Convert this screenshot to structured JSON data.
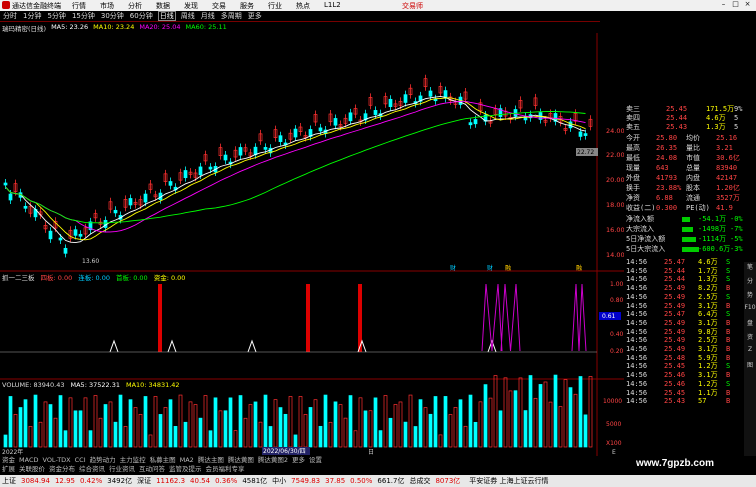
{
  "topbar": {
    "app_name": "通达信金融终端",
    "menu": [
      "行情",
      "市场",
      "分析",
      "数据",
      "发现",
      "交易",
      "服务",
      "行业",
      "热点",
      "L1L2"
    ],
    "brand": "交易师"
  },
  "periods": [
    "分时",
    "1分钟",
    "5分钟",
    "15分钟",
    "30分钟",
    "60分钟",
    "日线",
    "周线",
    "月线",
    "多周期",
    "更多"
  ],
  "stock": {
    "name": "瑞玛精密(日线)"
  },
  "ma": {
    "ma5": "MA5: 23.26",
    "ma10": "MA10: 23.24",
    "ma20": "MA20: 25.04",
    "ma60": "MA60: 25.11"
  },
  "colors": {
    "ma5": "#ffffff",
    "ma10": "#ffff00",
    "ma20": "#ff00ff",
    "ma60": "#00ff00",
    "up": "#ff3030",
    "down": "#00ffff"
  },
  "price_axis": [
    "24.00",
    "22.00",
    "20.00",
    "18.00",
    "16.00",
    "14.00"
  ],
  "low_label": "13.60",
  "cur_label": "22.72",
  "indicator": {
    "name": "抓一二三板",
    "l1": "四板: 0.00",
    "l2": "连板: 0.00",
    "l3": "首板: 0.00",
    "l4": "资金: 0.00",
    "axis": [
      "1.00",
      "0.80",
      "0.61",
      "0.40",
      "0.20"
    ]
  },
  "volume": {
    "label": "VOLUME: 83940.43",
    "ma5": "MA5: 37522.31",
    "ma10": "MA10: 34831.42",
    "axis": [
      "10000",
      "5000",
      "X100"
    ]
  },
  "dates": {
    "d1": "2022年",
    "d2": "2022/06/30/四",
    "d3": "日",
    "d4": "E"
  },
  "markers": [
    "财",
    "财",
    "融",
    "融"
  ],
  "orderbook": [
    {
      "label": "卖三",
      "price": "25.45",
      "vol": "171.5万",
      "rv": "9%"
    },
    {
      "label": "卖四",
      "price": "25.44",
      "vol": "4.6万",
      "rv": "5"
    },
    {
      "label": "卖五",
      "price": "25.43",
      "vol": "1.3万",
      "rv": "5"
    }
  ],
  "quote": [
    {
      "l1": "今开",
      "v1": "25.80",
      "l2": "均价",
      "v2": "25.16"
    },
    {
      "l1": "最高",
      "v1": "26.35",
      "l2": "量比",
      "v2": "3.21"
    },
    {
      "l1": "最低",
      "v1": "24.08",
      "l2": "市值",
      "v2": "30.6亿"
    },
    {
      "l1": "现量",
      "v1": "643",
      "l2": "总量",
      "v2": "83940"
    },
    {
      "l1": "外盘",
      "v1": "41793",
      "l2": "内盘",
      "v2": "42147"
    },
    {
      "l1": "换手",
      "v1": "23.88%",
      "l2": "股本",
      "v2": "1.20亿"
    },
    {
      "l1": "净资",
      "v1": "6.88",
      "l2": "流通",
      "v2": "3527万"
    },
    {
      "l1": "收益(二)",
      "v1": "0.300",
      "l2": "PE(动)",
      "v2": "41.9"
    }
  ],
  "flows": [
    {
      "label": "净流入额",
      "val": "-54.1万",
      "pct": "-0%"
    },
    {
      "label": "大宗流入",
      "val": "-1498万",
      "pct": "-7%"
    },
    {
      "label": "5日净流入额",
      "val": "-1114万",
      "pct": "-5%"
    },
    {
      "label": "5日大宗流入",
      "val": "-600.6万",
      "pct": "-3%"
    }
  ],
  "ticks": [
    {
      "t": "14:56",
      "p": "25.47",
      "v": "4.6万",
      "d": "S"
    },
    {
      "t": "14:56",
      "p": "25.44",
      "v": "1.7万",
      "d": "S"
    },
    {
      "t": "14:56",
      "p": "25.44",
      "v": "1.3万",
      "d": "S"
    },
    {
      "t": "14:56",
      "p": "25.49",
      "v": "8.2万",
      "d": "B"
    },
    {
      "t": "14:56",
      "p": "25.49",
      "v": "2.5万",
      "d": "S"
    },
    {
      "t": "14:56",
      "p": "25.49",
      "v": "3.1万",
      "d": "B"
    },
    {
      "t": "14:56",
      "p": "25.47",
      "v": "6.4万",
      "d": "S"
    },
    {
      "t": "14:56",
      "p": "25.49",
      "v": "3.1万",
      "d": "B"
    },
    {
      "t": "14:56",
      "p": "25.49",
      "v": "9.8万",
      "d": "B"
    },
    {
      "t": "14:56",
      "p": "25.49",
      "v": "2.5万",
      "d": "B"
    },
    {
      "t": "14:56",
      "p": "25.49",
      "v": "3.1万",
      "d": "B"
    },
    {
      "t": "14:56",
      "p": "25.48",
      "v": "5.9万",
      "d": "B"
    },
    {
      "t": "14:56",
      "p": "25.45",
      "v": "1.2万",
      "d": "S"
    },
    {
      "t": "14:56",
      "p": "25.46",
      "v": "3.1万",
      "d": "B"
    },
    {
      "t": "14:56",
      "p": "25.46",
      "v": "1.2万",
      "d": "S"
    },
    {
      "t": "14:56",
      "p": "25.45",
      "v": "1.1万",
      "d": "B"
    },
    {
      "t": "14:56",
      "p": "25.43",
      "v": "57",
      "d": "B"
    }
  ],
  "sidebar": [
    "笔",
    "分",
    "势",
    "F10",
    "盘",
    "资",
    "Z",
    "图"
  ],
  "tabs": [
    "扩展",
    "关联股价",
    "资金分布",
    "综合资讯",
    "行业资讯",
    "互动问答",
    "监管及提示",
    "会员福利专享"
  ],
  "tabs2": [
    "资金",
    "MACD",
    "VOL-TDX",
    "CCI",
    "趋势动力",
    "主力监控",
    "私募主图",
    "MA2",
    "腾达主图",
    "腾达黄图",
    "腾达黄图2",
    "更多",
    "设置"
  ],
  "status": [
    {
      "label": "上证",
      "val": "3084.94",
      "chg": "12.95",
      "pct": "0.42%",
      "amt": "3492亿",
      "cls": "up"
    },
    {
      "label": "深证",
      "val": "11162.3",
      "chg": "40.54",
      "pct": "0.36%",
      "amt": "4581亿",
      "cls": "up"
    },
    {
      "label": "中小",
      "val": "7549.83",
      "chg": "37.85",
      "pct": "0.50%",
      "amt": "661.7亿",
      "cls": "up"
    },
    {
      "label": "总成交",
      "val": "8073亿",
      "chg": "",
      "pct": "",
      "amt": "",
      "cls": "up"
    }
  ],
  "status_right": "平安证券 上海上证云行情",
  "watermark": "www.7gpzb.com"
}
